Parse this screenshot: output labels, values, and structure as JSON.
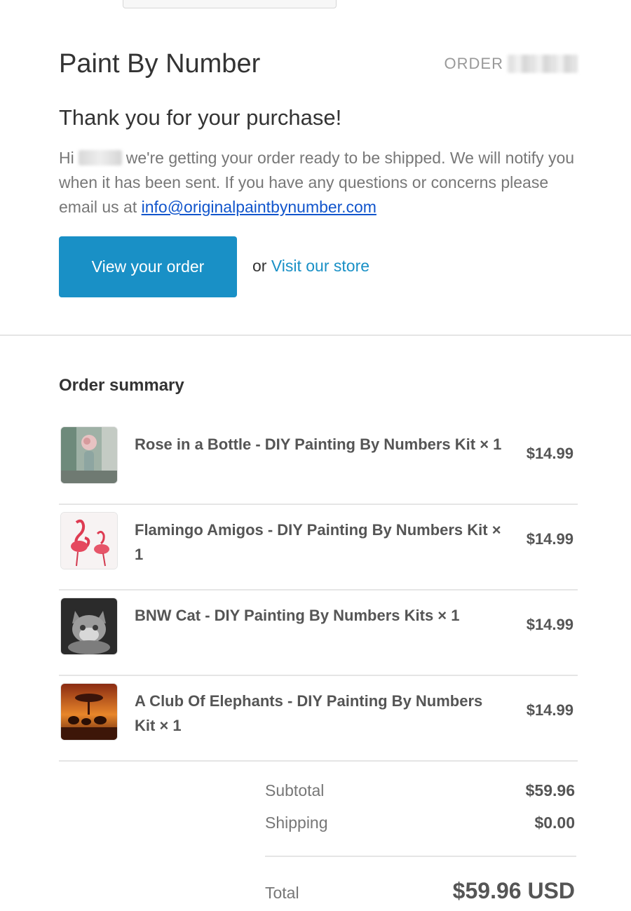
{
  "shop": {
    "name": "Paint By Number",
    "order_label": "ORDER"
  },
  "message": {
    "heading": "Thank you for your purchase!",
    "greeting": "Hi",
    "body": "we're getting your order ready to be shipped. We will notify you when it has been sent. If you have any questions or concerns please email us at",
    "email": "info@originalpaintbynumber.com"
  },
  "actions": {
    "view_order": "View your order",
    "or": "or",
    "visit_store": "Visit our store"
  },
  "summary": {
    "title": "Order summary",
    "items": [
      {
        "title": "Rose in a Bottle - DIY Painting By Numbers Kit × 1",
        "price": "$14.99",
        "thumb_icon": "rose-bottle-thumbnail"
      },
      {
        "title": "Flamingo Amigos - DIY Painting By Numbers Kit × 1",
        "price": "$14.99",
        "thumb_icon": "flamingo-thumbnail"
      },
      {
        "title": "BNW Cat - DIY Painting By Numbers Kits × 1",
        "price": "$14.99",
        "thumb_icon": "cat-thumbnail"
      },
      {
        "title": "A Club Of Elephants - DIY Painting By Numbers Kit × 1",
        "price": "$14.99",
        "thumb_icon": "elephants-thumbnail"
      }
    ]
  },
  "totals": {
    "subtotal_label": "Subtotal",
    "subtotal": "$59.96",
    "shipping_label": "Shipping",
    "shipping": "$0.00",
    "total_label": "Total",
    "total": "$59.96 USD"
  },
  "colors": {
    "button": "#1990c6",
    "link": "#1155cc",
    "divider": "#e5e5e5"
  }
}
